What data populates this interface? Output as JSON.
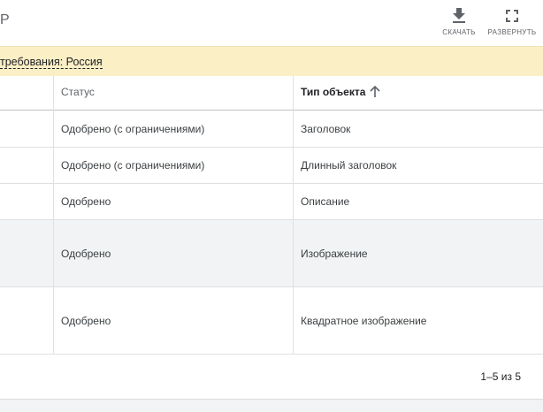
{
  "header": {
    "title_fragment": "Р",
    "download_label": "СКАЧАТЬ",
    "expand_label": "РАЗВЕРНУТЬ"
  },
  "banner": {
    "text": "требования: Россия"
  },
  "table": {
    "columns": [
      "Статус",
      "Тип объекта"
    ],
    "sorted_column": "Тип объекта",
    "sort_direction": "ascending",
    "rows": [
      {
        "status": "Одобрено (с ограничениями)",
        "type": "Заголовок"
      },
      {
        "status": "Одобрено (с ограничениями)",
        "type": "Длинный заголовок"
      },
      {
        "status": "Одобрено",
        "type": "Описание"
      },
      {
        "status": "Одобрено",
        "type": "Изображение"
      },
      {
        "status": "Одобрено",
        "type": "Квадратное изображение"
      }
    ]
  },
  "pagination": {
    "text": "1–5 из 5"
  },
  "icons": {
    "download": "download-icon",
    "expand": "fullscreen-icon",
    "sort": "arrow-up-icon"
  },
  "colors": {
    "banner_bg": "#fbefc6",
    "highlight_row": "#f1f3f4"
  }
}
